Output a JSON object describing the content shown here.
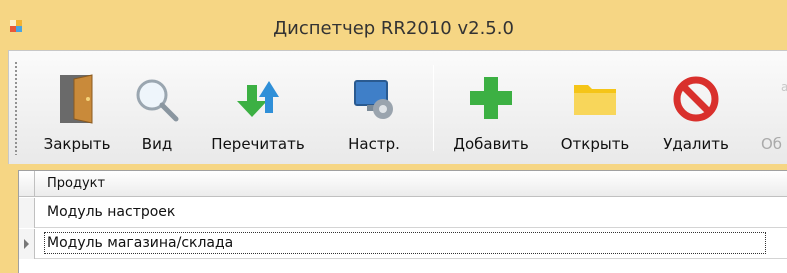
{
  "window": {
    "title": "Диспетчер RR2010 v2.5.0"
  },
  "toolbar": {
    "buttons": [
      {
        "label": "Закрыть",
        "icon": "door-exit-icon",
        "enabled": true
      },
      {
        "label": "Вид",
        "icon": "magnifier-icon",
        "enabled": true
      },
      {
        "label": "Перечитать",
        "icon": "refresh-arrows-icon",
        "enabled": true
      },
      {
        "label": "Настр.",
        "icon": "settings-monitor-gear-icon",
        "enabled": true
      },
      {
        "label": "Добавить",
        "icon": "green-plus-icon",
        "enabled": true
      },
      {
        "label": "Открыть",
        "icon": "folder-icon",
        "enabled": true
      },
      {
        "label": "Удалить",
        "icon": "red-prohibited-icon",
        "enabled": true
      },
      {
        "label": "Об",
        "icon": "info-icon",
        "enabled": false
      }
    ]
  },
  "grid": {
    "columns": [
      "Продукт"
    ],
    "rows": [
      {
        "product": "Модуль настроек",
        "current": false
      },
      {
        "product": "Модуль магазина/склада",
        "current": true
      }
    ]
  },
  "colors": {
    "titlebar": "#f6d684",
    "toolbar": "#f0f0f0",
    "accent_green": "#3cb043",
    "accent_red": "#d9302c",
    "folder": "#f5c518"
  }
}
